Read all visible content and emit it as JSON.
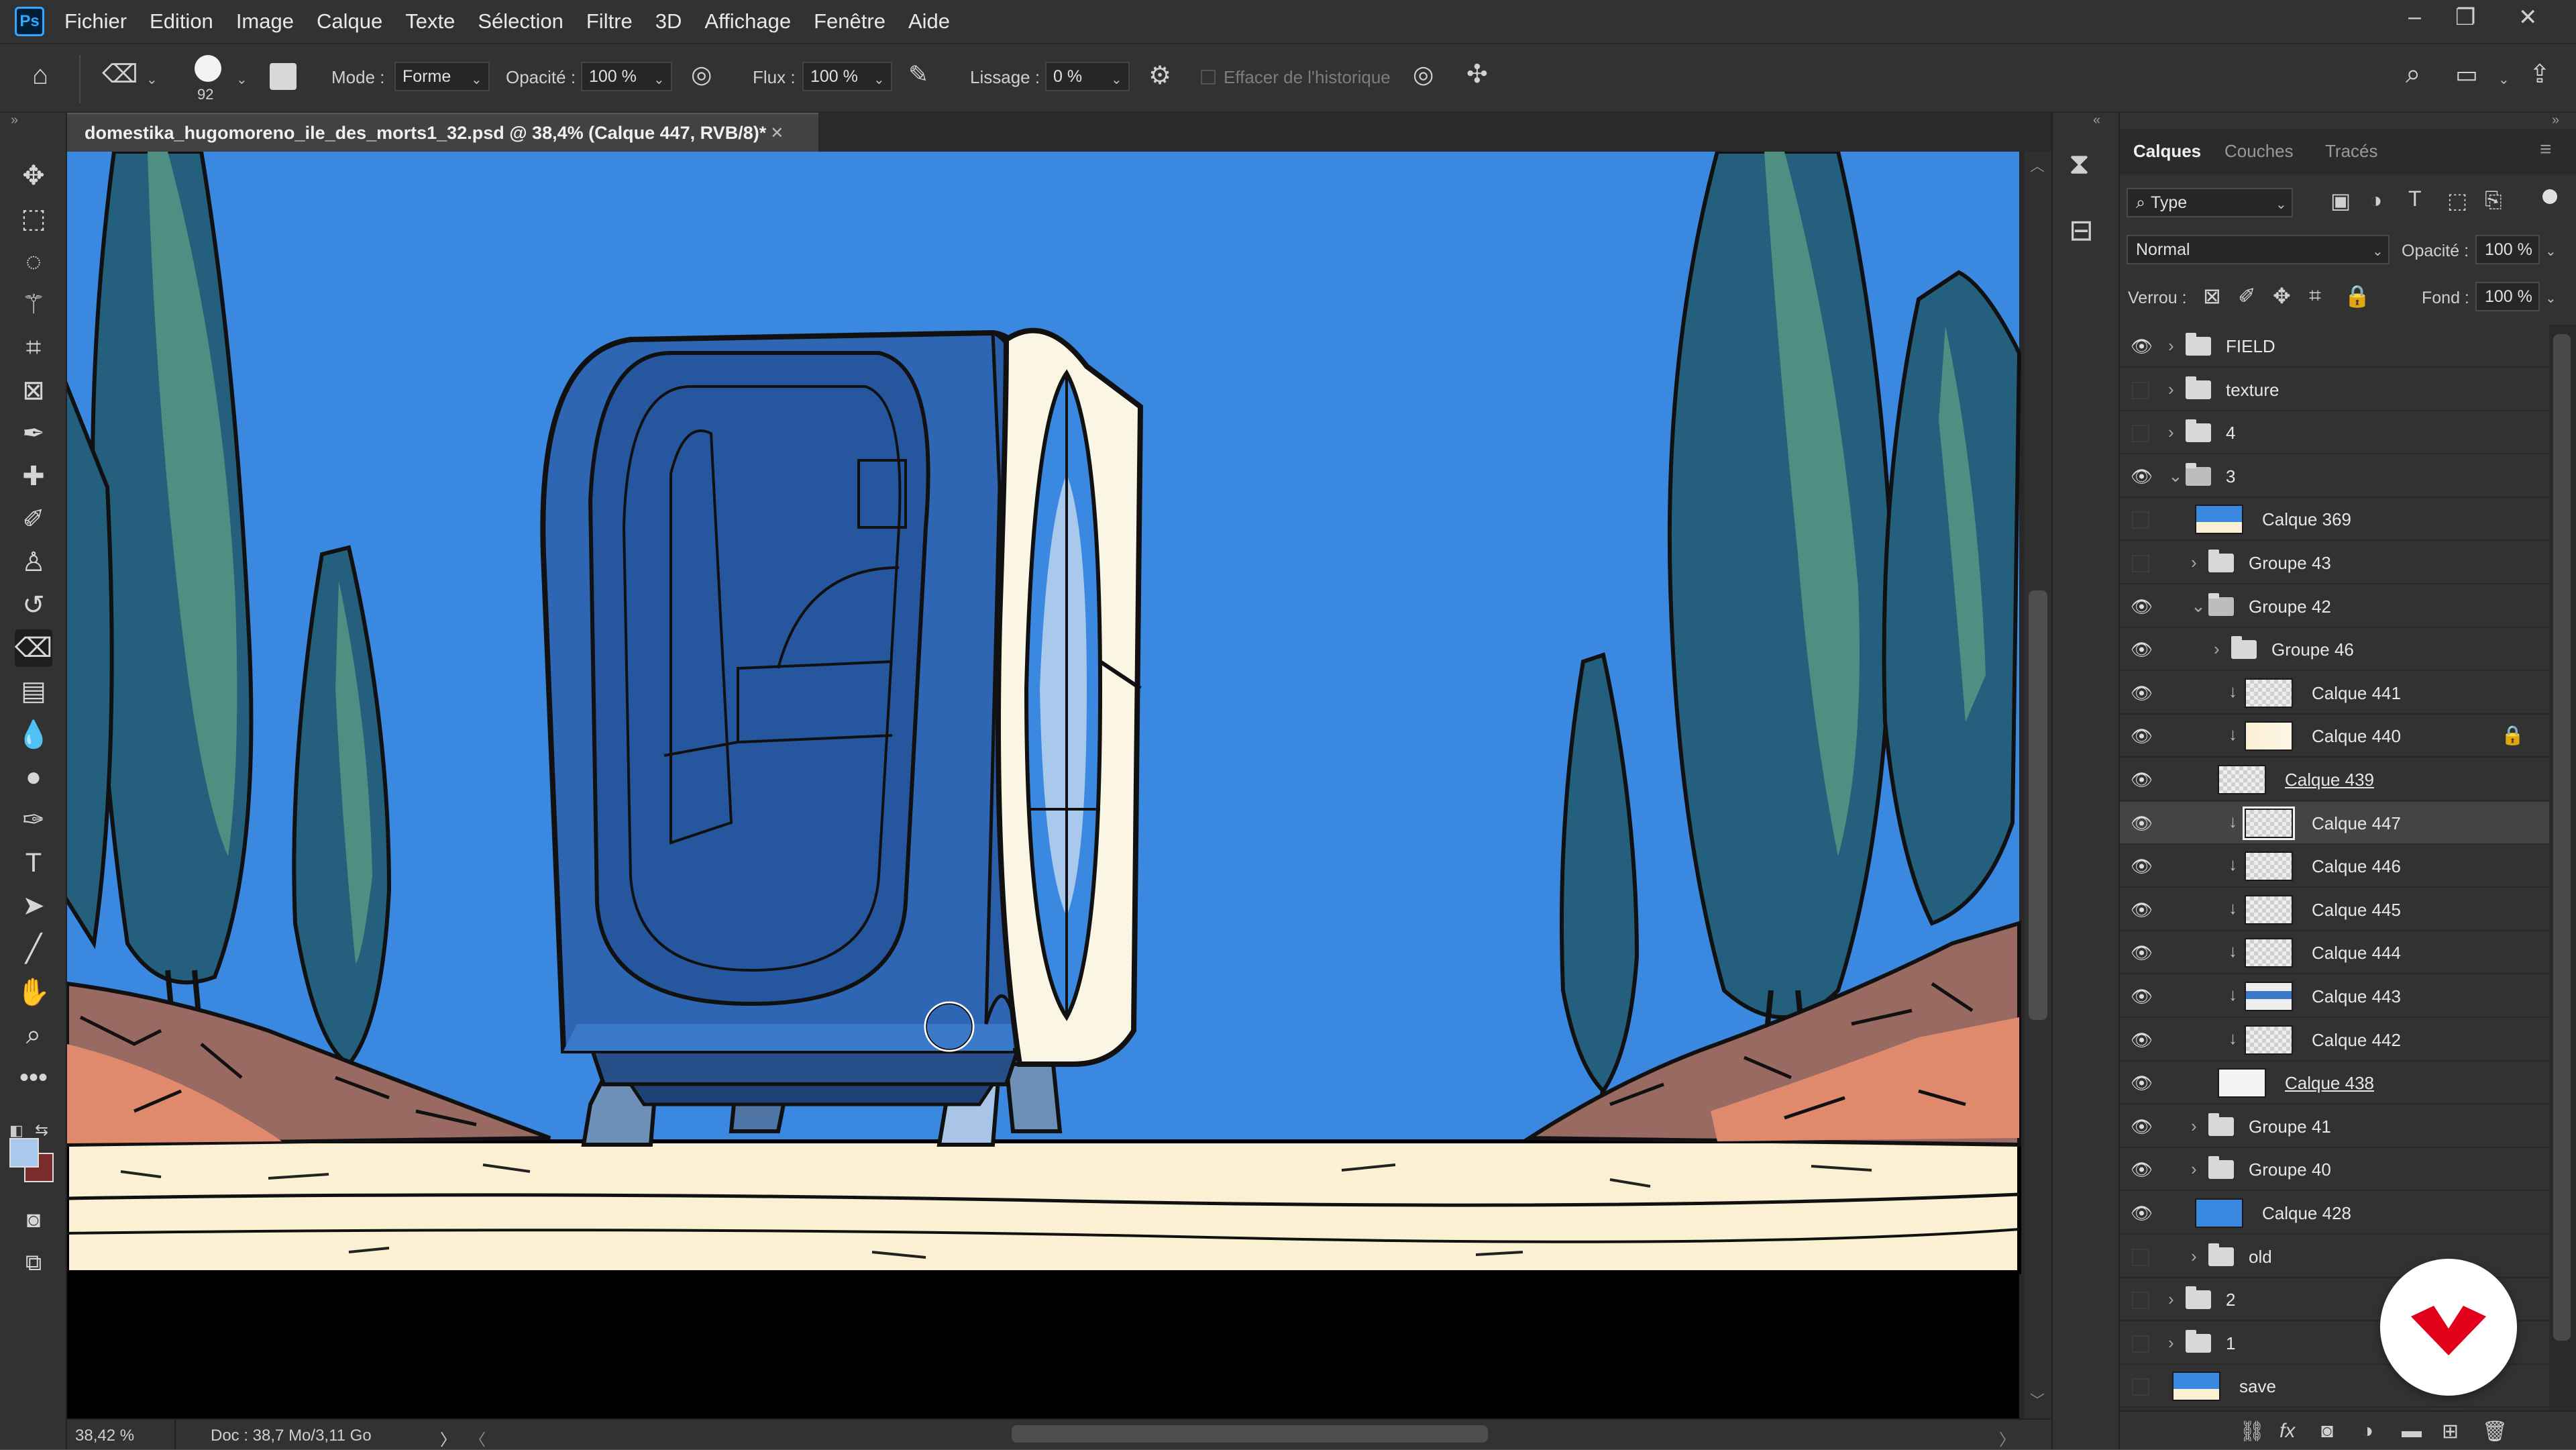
{
  "app": {
    "logo_text": "Ps"
  },
  "menu": [
    "Fichier",
    "Edition",
    "Image",
    "Calque",
    "Texte",
    "Sélection",
    "Filtre",
    "3D",
    "Affichage",
    "Fenêtre",
    "Aide"
  ],
  "options": {
    "brush_size": "92",
    "mode_label": "Mode :",
    "mode_value": "Forme",
    "opacity_label": "Opacité :",
    "opacity_value": "100 %",
    "flow_label": "Flux :",
    "flow_value": "100 %",
    "smoothing_label": "Lissage :",
    "smoothing_value": "0 %",
    "erase_history_label": "Effacer de l'historique"
  },
  "document": {
    "tab_title": "domestika_hugomoreno_ile_des_morts1_32.psd @ 38,4% (Calque 447, RVB/8)",
    "tab_modified": "*",
    "zoom": "38,42 %",
    "doc_info": "Doc : 38,7 Mo/3,11 Go"
  },
  "layers_panel": {
    "tabs": [
      "Calques",
      "Couches",
      "Tracés"
    ],
    "filter_value": "Type",
    "blend_mode": "Normal",
    "opacity_label": "Opacité :",
    "opacity_value": "100 %",
    "lock_label": "Verrou :",
    "fill_label": "Fond :",
    "fill_value": "100 %"
  },
  "layers": [
    {
      "name": "FIELD",
      "type": "group",
      "visible": true,
      "depth": 0,
      "open": false
    },
    {
      "name": "texture",
      "type": "group",
      "visible": false,
      "depth": 0,
      "open": false
    },
    {
      "name": "4",
      "type": "group",
      "visible": false,
      "depth": 0,
      "open": false
    },
    {
      "name": "3",
      "type": "group",
      "visible": true,
      "depth": 0,
      "open": true
    },
    {
      "name": "Calque 369",
      "type": "layer",
      "visible": false,
      "depth": 1,
      "thumb": "scene"
    },
    {
      "name": "Groupe 43",
      "type": "group",
      "visible": false,
      "depth": 1,
      "open": false
    },
    {
      "name": "Groupe 42",
      "type": "group",
      "visible": true,
      "depth": 1,
      "open": true
    },
    {
      "name": "Groupe 46",
      "type": "group",
      "visible": true,
      "depth": 2,
      "open": false
    },
    {
      "name": "Calque 441",
      "type": "layer",
      "visible": true,
      "depth": 2,
      "clipped": true,
      "thumb": "mark"
    },
    {
      "name": "Calque 440",
      "type": "layer",
      "visible": true,
      "depth": 2,
      "clipped": true,
      "locked": true,
      "thumb": "cream"
    },
    {
      "name": "Calque 439",
      "type": "layer",
      "visible": true,
      "depth": 2,
      "underline": true,
      "thumb": "pale"
    },
    {
      "name": "Calque 447",
      "type": "layer",
      "visible": true,
      "depth": 2,
      "clipped": true,
      "selected": true,
      "thumb": "empty"
    },
    {
      "name": "Calque 446",
      "type": "layer",
      "visible": true,
      "depth": 2,
      "clipped": true,
      "thumb": "low"
    },
    {
      "name": "Calque 445",
      "type": "layer",
      "visible": true,
      "depth": 2,
      "clipped": true,
      "thumb": "empty"
    },
    {
      "name": "Calque 444",
      "type": "layer",
      "visible": true,
      "depth": 2,
      "clipped": true,
      "thumb": "empty"
    },
    {
      "name": "Calque 443",
      "type": "layer",
      "visible": true,
      "depth": 2,
      "clipped": true,
      "thumb": "bluebar"
    },
    {
      "name": "Calque 442",
      "type": "layer",
      "visible": true,
      "depth": 2,
      "clipped": true,
      "thumb": "bluemark"
    },
    {
      "name": "Calque 438",
      "type": "layer",
      "visible": true,
      "depth": 2,
      "underline": true,
      "thumb": "white"
    },
    {
      "name": "Groupe 41",
      "type": "group",
      "visible": true,
      "depth": 1,
      "open": false
    },
    {
      "name": "Groupe 40",
      "type": "group",
      "visible": true,
      "depth": 1,
      "open": false
    },
    {
      "name": "Calque 428",
      "type": "layer",
      "visible": true,
      "depth": 1,
      "thumb": "blue"
    },
    {
      "name": "old",
      "type": "group",
      "visible": false,
      "depth": 1,
      "open": false
    },
    {
      "name": "2",
      "type": "group",
      "visible": false,
      "depth": 0,
      "open": false
    },
    {
      "name": "1",
      "type": "group",
      "visible": false,
      "depth": 0,
      "open": false
    },
    {
      "name": "save",
      "type": "layer",
      "visible": false,
      "depth": 0,
      "thumb": "scene"
    }
  ],
  "colors": {
    "sky": "#3b88e0",
    "ground": "#fbf0d4",
    "machine": "#2f66b4",
    "machine_dark": "#25569e",
    "cream_ring": "#fbf5e4",
    "tree_dark": "#245f7e",
    "tree_light": "#4f8f82",
    "rock_orange": "#df8a6c",
    "rock_brown": "#986a62",
    "foreground_color": "#a8c8ec",
    "background_color": "#7a2b2b",
    "watermark_red": "#e2001a"
  }
}
